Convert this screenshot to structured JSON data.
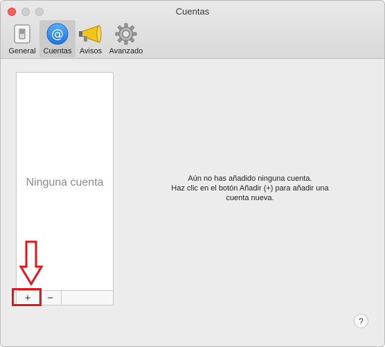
{
  "window": {
    "title": "Cuentas"
  },
  "toolbar": {
    "tabs": [
      {
        "label": "General",
        "icon": "switch-icon"
      },
      {
        "label": "Cuentas",
        "icon": "at-sign-icon"
      },
      {
        "label": "Avisos",
        "icon": "megaphone-icon"
      },
      {
        "label": "Avanzado",
        "icon": "gear-icon"
      }
    ]
  },
  "accounts_list": {
    "empty_text": "Ninguna cuenta",
    "add_label": "+",
    "remove_label": "−"
  },
  "message": {
    "line1": "Aún no has añadido ninguna cuenta.",
    "line2": "Haz clic en el botón Añadir (+) para añadir una",
    "line3": "cuenta nueva."
  },
  "help": {
    "label": "?"
  },
  "colors": {
    "annotation": "#e2151c",
    "accent": "#2a8bf2"
  }
}
